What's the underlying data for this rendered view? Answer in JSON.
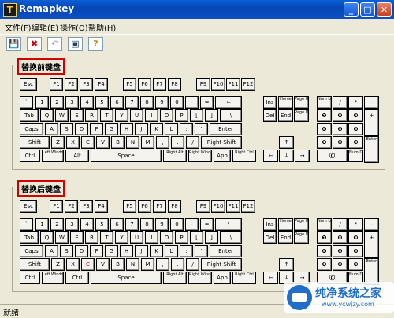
{
  "window": {
    "title": "Remapkey",
    "icon_glyph": "T",
    "minimize": "_",
    "maximize": "□",
    "close": "✕"
  },
  "menu": [
    {
      "label": "文件(F)"
    },
    {
      "label": "编辑(E)"
    },
    {
      "label": "操作(O)"
    },
    {
      "label": "帮助(H)"
    }
  ],
  "toolbar": [
    {
      "name": "save-icon",
      "glyph": "💾"
    },
    {
      "name": "delete-icon",
      "glyph": "✖"
    },
    {
      "name": "reset-icon",
      "glyph": "↶"
    },
    {
      "name": "view-icon",
      "glyph": "▣"
    },
    {
      "name": "help-icon",
      "glyph": "?"
    }
  ],
  "groups": {
    "top_label": "替换前键盘",
    "bottom_label": "替换后键盘"
  },
  "top_keys": [
    "Esc",
    "F1",
    "F2",
    "F3",
    "F4",
    "F5",
    "F6",
    "F7",
    "F8",
    "F9",
    "F10",
    "F11",
    "F12",
    "`",
    "1",
    "2",
    "3",
    "4",
    "5",
    "6",
    "7",
    "8",
    "9",
    "0",
    "-",
    "=",
    "⇦",
    "Ins",
    "Home",
    "Page Up",
    "Num Lock",
    "/",
    "*",
    "-",
    "Tab",
    "Q",
    "W",
    "E",
    "R",
    "T",
    "Y",
    "U",
    "I",
    "O",
    "P",
    "[",
    "]",
    "\\",
    "Del",
    "End",
    "Page Down",
    "❼",
    "❽",
    "❾",
    "+",
    "Caps",
    "A",
    "S",
    "D",
    "F",
    "G",
    "H",
    "J",
    "K",
    "L",
    ";",
    "'",
    "Enter",
    "❹",
    "❺",
    "❻",
    "Shift",
    "Z",
    "X",
    "C",
    "V",
    "B",
    "N",
    "M",
    ",",
    ".",
    "/",
    "Right Shift",
    "↑",
    "❶",
    "❷",
    "❸",
    "Enter",
    "Ctrl",
    "Left Windows",
    "Alt",
    "Space",
    "Right Alt",
    "Right Windows",
    "App",
    "Right Ctrl",
    "←",
    "↓",
    "→",
    "⓪",
    "Num Del"
  ],
  "bottom_keys": [
    "Esc",
    "F1",
    "F2",
    "F3",
    "F4",
    "F5",
    "F6",
    "F7",
    "F8",
    "F9",
    "F10",
    "F11",
    "F12",
    "`",
    "1",
    "2",
    "3",
    "4",
    "5",
    "6",
    "7",
    "8",
    "9",
    "0",
    "-",
    "=",
    "\\",
    "Ins",
    "Home",
    "Page Up",
    "Num Lock",
    "/",
    "*",
    "-",
    "Tab",
    "Q",
    "W",
    "E",
    "R",
    "T",
    "Y",
    "U",
    "I",
    "O",
    "P",
    "[",
    "]",
    "\\",
    "Del",
    "End",
    "Page Down",
    "❼",
    "❽",
    "❾",
    "+",
    "Caps",
    "A",
    "S",
    "D",
    "F",
    "G",
    "H",
    "J",
    "K",
    "L",
    ";",
    "'",
    "Enter",
    "❹",
    "❺",
    "❻",
    "Shift",
    "Z",
    "X",
    "C",
    "V",
    "B",
    "N",
    "M",
    ",",
    ".",
    "/",
    "Right Shift",
    "↑",
    "❶",
    "❷",
    "❸",
    "Enter",
    "Ctrl",
    "Left Windows",
    "Ctrl",
    "Space",
    "Right Alt",
    "Right Windows",
    "App",
    "Right Ctrl",
    "←",
    "↓",
    "→",
    "⓪",
    "Num Del"
  ],
  "status": {
    "text": "就绪"
  },
  "watermark": {
    "title": "纯净系统之家",
    "url": "www.ycwjzy.com"
  }
}
